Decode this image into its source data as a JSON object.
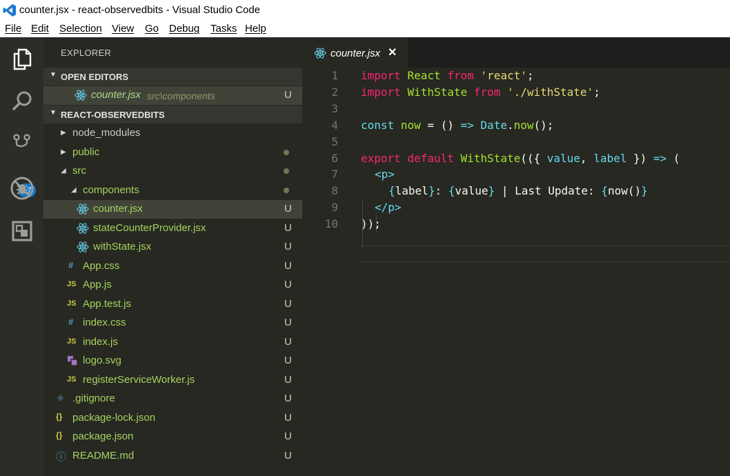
{
  "window": {
    "title": "counter.jsx - react-observedbits - Visual Studio Code"
  },
  "menu": [
    "File",
    "Edit",
    "Selection",
    "View",
    "Go",
    "Debug",
    "Tasks",
    "Help"
  ],
  "activity": {
    "scm_badge": "17",
    "icons": [
      "files-icon",
      "search-icon",
      "source-control-icon",
      "debug-icon",
      "extensions-icon"
    ]
  },
  "sidebar": {
    "title": "EXPLORER",
    "open_editors_label": "OPEN EDITORS",
    "open_editor": {
      "name": "counter.jsx",
      "path": "src\\components",
      "status": "U"
    },
    "project_label": "REACT-OBSERVEDBITS",
    "tree": [
      {
        "name": "node_modules",
        "kind": "folder",
        "expanded": false,
        "status": "",
        "dot": false
      },
      {
        "name": "public",
        "kind": "folder",
        "expanded": false,
        "status": "",
        "dot": true
      },
      {
        "name": "src",
        "kind": "folder",
        "expanded": true,
        "status": "",
        "dot": true
      },
      {
        "name": "components",
        "kind": "folder",
        "expanded": true,
        "status": "",
        "dot": true
      },
      {
        "name": "counter.jsx",
        "kind": "react",
        "status": "U"
      },
      {
        "name": "stateCounterProvider.jsx",
        "kind": "react",
        "status": "U"
      },
      {
        "name": "withState.jsx",
        "kind": "react",
        "status": "U"
      },
      {
        "name": "App.css",
        "kind": "css",
        "status": "U"
      },
      {
        "name": "App.js",
        "kind": "js",
        "status": "U"
      },
      {
        "name": "App.test.js",
        "kind": "js",
        "status": "U"
      },
      {
        "name": "index.css",
        "kind": "css",
        "status": "U"
      },
      {
        "name": "index.js",
        "kind": "js",
        "status": "U"
      },
      {
        "name": "logo.svg",
        "kind": "svg",
        "status": "U"
      },
      {
        "name": "registerServiceWorker.js",
        "kind": "js",
        "status": "U"
      },
      {
        "name": ".gitignore",
        "kind": "git",
        "status": "U"
      },
      {
        "name": "package-lock.json",
        "kind": "json",
        "status": "U"
      },
      {
        "name": "package.json",
        "kind": "json",
        "status": "U"
      },
      {
        "name": "README.md",
        "kind": "info",
        "status": "U"
      }
    ]
  },
  "editor": {
    "tab": {
      "name": "counter.jsx",
      "close_glyph": "✕"
    },
    "icon_glyphs": {
      "css": "#",
      "js": "JS",
      "json": "{}",
      "info": "ⓘ",
      "git": "◆"
    },
    "lines": [
      "1",
      "2",
      "3",
      "4",
      "5",
      "6",
      "7",
      "8",
      "9",
      "10"
    ],
    "code": {
      "l1": {
        "k1": "import",
        "id": "React",
        "k2": "from",
        "str": "'react'",
        "end": ";"
      },
      "l2": {
        "k1": "import",
        "id": "WithState",
        "k2": "from",
        "str": "'./withState'",
        "end": ";"
      },
      "l4": {
        "k1": "const",
        "id": "now",
        "eq": " = () ",
        "arrow": "=>",
        "obj": "Date",
        "dot": ".",
        "fn": "now",
        "end": "();"
      },
      "l6": {
        "k1": "export",
        "k2": "default",
        "fn": "WithState",
        "open": "(({ ",
        "p1": "value",
        "comma": ", ",
        "p2": "label",
        "close": " }) ",
        "arrow": "=>",
        "end": " ("
      },
      "l7": {
        "lt": "<",
        "tag": "p",
        "gt": ">"
      },
      "l8": {
        "o1": "{",
        "e1": "label",
        "c1": "}",
        "mid": ": ",
        "o2": "{",
        "e2": "value",
        "c2": "}",
        "text": " | Last Update: ",
        "o3": "{",
        "e3": "now()",
        "c3": "}"
      },
      "l9": {
        "lt": "</",
        "tag": "p",
        "gt": ">"
      },
      "l10": {
        "text": "));"
      }
    }
  }
}
